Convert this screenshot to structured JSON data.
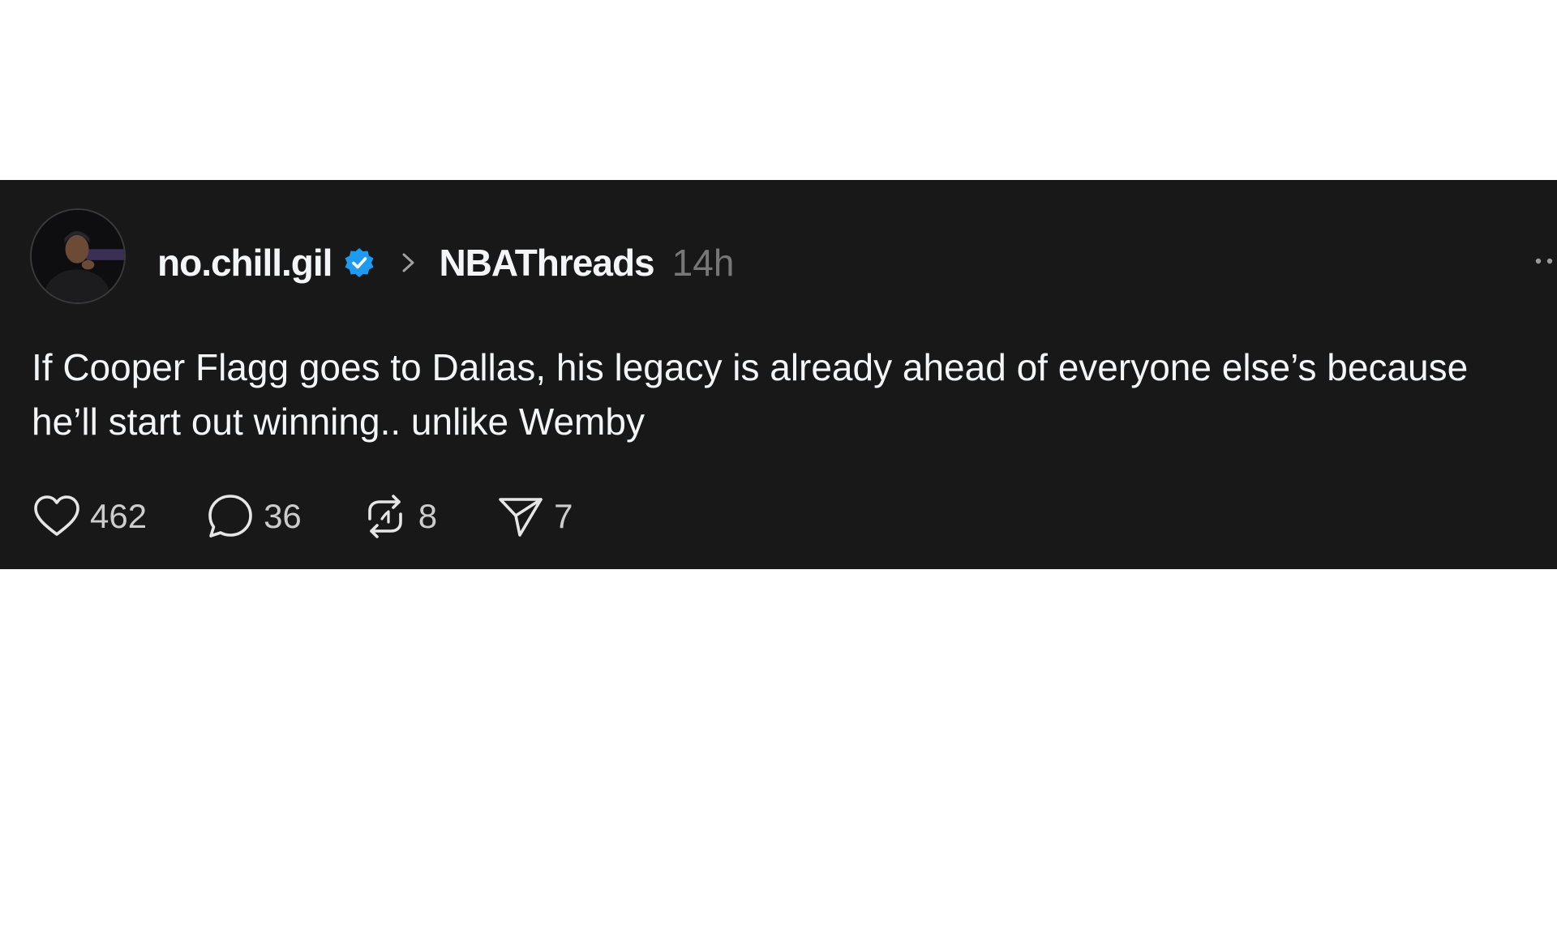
{
  "post": {
    "author": {
      "username": "no.chill.gil",
      "verified": true,
      "avatar": "avatar-photo"
    },
    "community": "NBAThreads",
    "timestamp": "14h",
    "text": "If Cooper Flagg goes to Dallas, his legacy is already ahead of everyone else’s because he’ll start out winning.. unlike Wemby",
    "actions": {
      "like": {
        "icon": "heart-icon",
        "count": "462"
      },
      "reply": {
        "icon": "comment-icon",
        "count": "36"
      },
      "repost": {
        "icon": "repost-icon",
        "count": "8"
      },
      "share": {
        "icon": "send-icon",
        "count": "7"
      }
    }
  },
  "colors": {
    "background": "#181818",
    "text": "#f3f5f7",
    "muted": "#777777",
    "verified": "#1d9bf0"
  }
}
